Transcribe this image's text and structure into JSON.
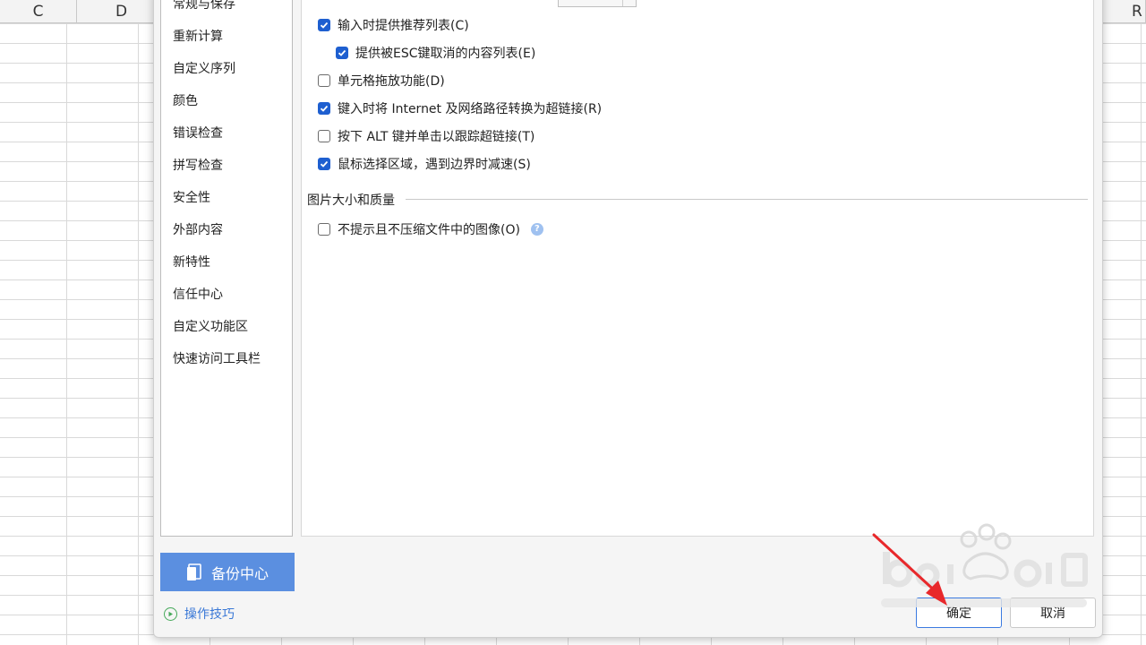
{
  "sheet": {
    "col_c": "C",
    "col_d": "D",
    "col_r": "R"
  },
  "sidebar": {
    "items": [
      {
        "label": "常规与保存"
      },
      {
        "label": "重新计算"
      },
      {
        "label": "自定义序列"
      },
      {
        "label": "颜色"
      },
      {
        "label": "错误检查"
      },
      {
        "label": "拼写检查"
      },
      {
        "label": "安全性"
      },
      {
        "label": "外部内容"
      },
      {
        "label": "新特性"
      },
      {
        "label": "信任中心"
      },
      {
        "label": "自定义功能区"
      },
      {
        "label": "快速访问工具栏"
      }
    ],
    "backup_label": "备份中心",
    "tips_label": "操作技巧"
  },
  "options": {
    "recommend_list": {
      "label": "输入时提供推荐列表(C)",
      "checked": true
    },
    "esc_list": {
      "label": "提供被ESC键取消的内容列表(E)",
      "checked": true
    },
    "drag_drop": {
      "label": "单元格拖放功能(D)",
      "checked": false
    },
    "hyperlink_convert": {
      "label": "键入时将 Internet 及网络路径转换为超链接(R)",
      "checked": true
    },
    "alt_click": {
      "label": "按下 ALT 键并单击以跟踪超链接(T)",
      "checked": false
    },
    "slow_border": {
      "label": "鼠标选择区域，遇到边界时减速(S)",
      "checked": true
    }
  },
  "image_section": {
    "title": "图片大小和质量",
    "no_compress": {
      "label": "不提示且不压缩文件中的图像(O)",
      "checked": false
    }
  },
  "buttons": {
    "ok": "确定",
    "cancel": "取消"
  },
  "colors": {
    "accent": "#1e5fd0",
    "backup_button": "#5b8fe0",
    "arrow": "#e8282b"
  }
}
